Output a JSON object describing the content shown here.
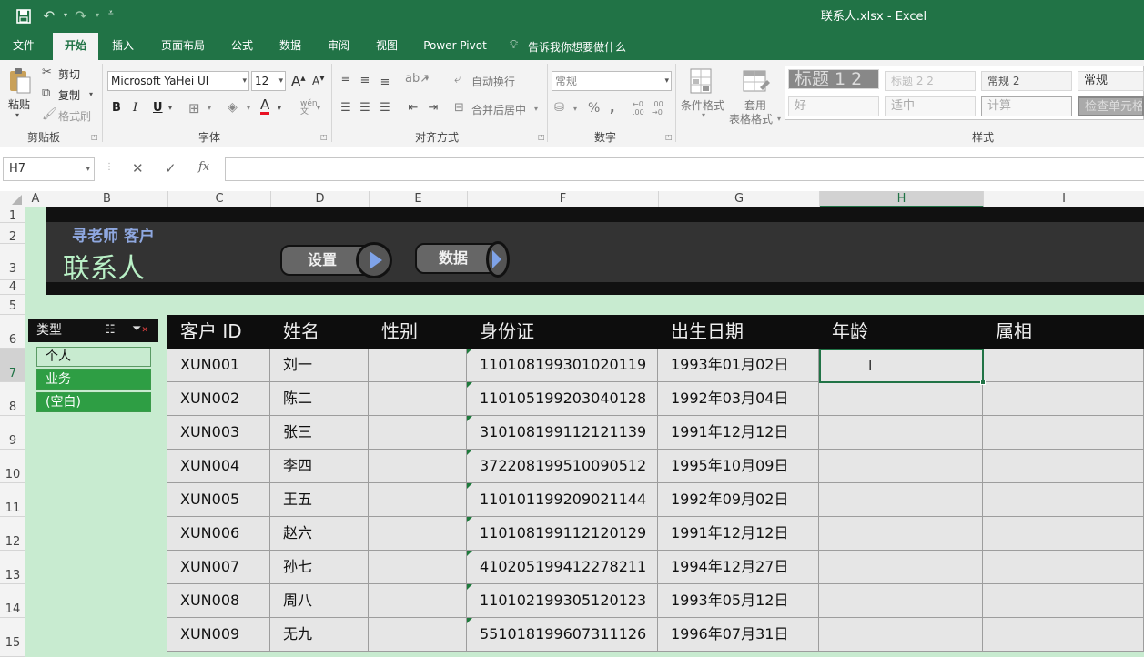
{
  "window": {
    "title": "联系人.xlsx  -  Excel"
  },
  "quick_access": {
    "save_icon": "save-icon",
    "undo_icon": "undo-icon",
    "redo_icon": "redo-icon",
    "customize_icon": "customize-qat-icon"
  },
  "menu_tabs": [
    {
      "label": "文件"
    },
    {
      "label": "开始"
    },
    {
      "label": "插入"
    },
    {
      "label": "页面布局"
    },
    {
      "label": "公式"
    },
    {
      "label": "数据"
    },
    {
      "label": "审阅"
    },
    {
      "label": "视图"
    },
    {
      "label": "Power Pivot"
    }
  ],
  "tell_me": "告诉我你想要做什么",
  "ribbon": {
    "clipboard": {
      "paste": "粘贴",
      "cut": "剪切",
      "copy": "复制",
      "format_painter": "格式刷",
      "group_label": "剪贴板"
    },
    "font": {
      "font_name": "Microsoft YaHei UI",
      "font_size": "12",
      "grow": "A",
      "shrink": "A",
      "bold": "B",
      "italic": "I",
      "underline": "U",
      "font_color_glyph": "A",
      "phonetic": "wén",
      "group_label": "字体"
    },
    "alignment": {
      "wrap_text": "自动换行",
      "merge_center": "合并后居中",
      "group_label": "对齐方式"
    },
    "number": {
      "format": "常规",
      "percent": "%",
      "comma": ",",
      "group_label": "数字"
    },
    "styles": {
      "conditional_formatting": "条件格式",
      "format_as_table_1": "套用",
      "format_as_table_2": "表格格式",
      "cells": [
        {
          "label": "标题 1 2"
        },
        {
          "label": "标题 2 2"
        },
        {
          "label": "常规 2"
        },
        {
          "label": "常规"
        },
        {
          "label": "好"
        },
        {
          "label": "适中"
        },
        {
          "label": "计算"
        },
        {
          "label": "检查单元格"
        }
      ],
      "group_label": "样式"
    }
  },
  "formula_bar": {
    "name_box": "H7",
    "cancel": "✕",
    "enter": "✓",
    "fx": "fx",
    "value": ""
  },
  "columns": [
    "A",
    "B",
    "C",
    "D",
    "E",
    "F",
    "G",
    "H",
    "I"
  ],
  "rows": [
    "1",
    "2",
    "3",
    "4",
    "5",
    "6",
    "7",
    "8",
    "9",
    "10",
    "11",
    "12",
    "13",
    "14",
    "15"
  ],
  "banner": {
    "subtitle": "寻老师 客户",
    "title": "联系人",
    "settings_button": "设置",
    "data_button": "数据"
  },
  "slicer": {
    "title": "类型",
    "items": [
      {
        "label": "个人",
        "selected": false
      },
      {
        "label": "业务",
        "selected": true
      },
      {
        "label": "(空白)",
        "selected": true
      }
    ]
  },
  "table": {
    "headers": [
      "客户 ID",
      "姓名",
      "性别",
      "身份证",
      "出生日期",
      "年龄",
      "属相"
    ],
    "rows": [
      [
        "XUN001",
        "刘一",
        "",
        "110108199301020119",
        "1993年01月02日",
        "",
        ""
      ],
      [
        "XUN002",
        "陈二",
        "",
        "110105199203040128",
        "1992年03月04日",
        "",
        ""
      ],
      [
        "XUN003",
        "张三",
        "",
        "310108199112121139",
        "1991年12月12日",
        "",
        ""
      ],
      [
        "XUN004",
        "李四",
        "",
        "372208199510090512",
        "1995年10月09日",
        "",
        ""
      ],
      [
        "XUN005",
        "王五",
        "",
        "110101199209021144",
        "1992年09月02日",
        "",
        ""
      ],
      [
        "XUN006",
        "赵六",
        "",
        "110108199112120129",
        "1991年12月12日",
        "",
        ""
      ],
      [
        "XUN007",
        "孙七",
        "",
        "410205199412278211",
        "1994年12月27日",
        "",
        ""
      ],
      [
        "XUN008",
        "周八",
        "",
        "110102199305120123",
        "1993年05月12日",
        "",
        ""
      ],
      [
        "XUN009",
        "无九",
        "",
        "551018199607311126",
        "1996年07月31日",
        "",
        ""
      ]
    ]
  },
  "colors": {
    "excel_green": "#217346",
    "sheet_background": "#c8ebd0",
    "banner_dark": "#111111",
    "slicer_selected": "#2e9e44",
    "slicer_unselected": "#c8ebd0"
  }
}
